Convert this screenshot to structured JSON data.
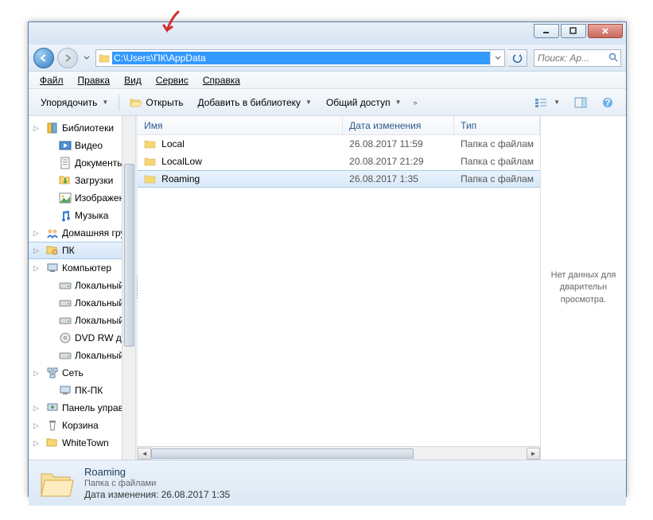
{
  "address_path": "C:\\Users\\ПК\\AppData",
  "search_placeholder": "Поиск: Ap...",
  "menu": {
    "file": "Файл",
    "edit": "Правка",
    "view": "Вид",
    "tools": "Сервис",
    "help": "Справка"
  },
  "toolbar": {
    "organize": "Упорядочить",
    "open": "Открыть",
    "library": "Добавить в библиотеку",
    "share": "Общий доступ"
  },
  "sidebar": {
    "items": [
      {
        "label": "Библиотеки",
        "icon": "libraries"
      },
      {
        "label": "Видео",
        "icon": "video",
        "indent": 1
      },
      {
        "label": "Документы",
        "icon": "documents",
        "indent": 1
      },
      {
        "label": "Загрузки",
        "icon": "downloads",
        "indent": 1
      },
      {
        "label": "Изображения",
        "icon": "pictures",
        "indent": 1
      },
      {
        "label": "Музыка",
        "icon": "music",
        "indent": 1
      },
      {
        "label": "Домашняя группа",
        "icon": "homegroup"
      },
      {
        "label": "ПК",
        "icon": "user",
        "selected": true
      },
      {
        "label": "Компьютер",
        "icon": "computer"
      },
      {
        "label": "Локальный диск (C",
        "icon": "drive",
        "indent": 1
      },
      {
        "label": "Локальный диск (D",
        "icon": "drive",
        "indent": 1
      },
      {
        "label": "Локальный диск (E",
        "icon": "drive",
        "indent": 1
      },
      {
        "label": "DVD RW дисковод (",
        "icon": "dvd",
        "indent": 1
      },
      {
        "label": "Локальный диск (Y",
        "icon": "drive",
        "indent": 1
      },
      {
        "label": "Сеть",
        "icon": "network"
      },
      {
        "label": "ПК-ПК",
        "icon": "pc",
        "indent": 1
      },
      {
        "label": "Панель управления",
        "icon": "control"
      },
      {
        "label": "Корзина",
        "icon": "recycle"
      },
      {
        "label": "WhiteTown",
        "icon": "folder"
      }
    ]
  },
  "columns": {
    "name": "Имя",
    "date": "Дата изменения",
    "type": "Тип"
  },
  "files": [
    {
      "name": "Local",
      "date": "26.08.2017 11:59",
      "type": "Папка с файлам"
    },
    {
      "name": "LocalLow",
      "date": "20.08.2017 21:29",
      "type": "Папка с файлам"
    },
    {
      "name": "Roaming",
      "date": "26.08.2017 1:35",
      "type": "Папка с файлам",
      "selected": true
    }
  ],
  "preview": {
    "text": "Нет данных для дварительн просмотра."
  },
  "details": {
    "name": "Roaming",
    "type": "Папка с файлами",
    "date_label": "Дата изменения:",
    "date_value": "26.08.2017 1:35"
  }
}
